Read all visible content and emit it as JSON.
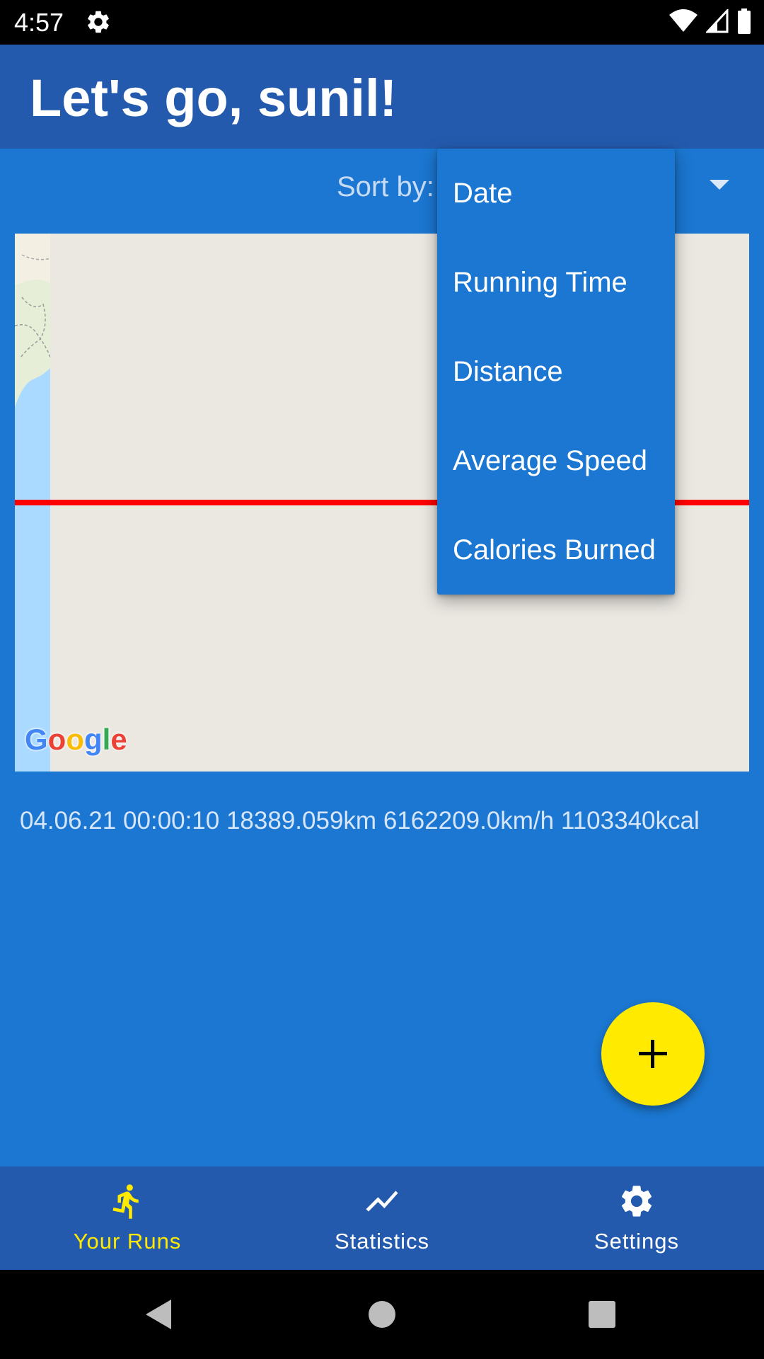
{
  "status_bar": {
    "time": "4:57",
    "icons": [
      "settings-gear-icon",
      "wifi-icon",
      "signal-icon",
      "battery-icon"
    ]
  },
  "app_bar": {
    "title": "Let's go, sunil!"
  },
  "sort": {
    "label": "Sort by:",
    "dropdown_open": true,
    "options": [
      "Date",
      "Running Time",
      "Distance",
      "Average Speed",
      "Calories Burned"
    ]
  },
  "map": {
    "provider_logo": "Google",
    "route_color": "#ff0000"
  },
  "runs": [
    {
      "date": "04.06.21",
      "time": "00:00:10",
      "distance": "18389.059km",
      "speed": "6162209.0km/h",
      "calories": "1103340kcal"
    }
  ],
  "fab": {
    "icon": "plus-icon",
    "color": "#ffea00"
  },
  "bottom_nav": {
    "items": [
      {
        "label": "Your Runs",
        "icon": "runner-icon",
        "active": true
      },
      {
        "label": "Statistics",
        "icon": "trend-line-icon",
        "active": false
      },
      {
        "label": "Settings",
        "icon": "gear-icon",
        "active": false
      }
    ],
    "active_color": "#ffea00",
    "inactive_color": "#ffffff"
  },
  "colors": {
    "app_bar": "#245aad",
    "background": "#1b77d1",
    "accent": "#ffea00"
  }
}
